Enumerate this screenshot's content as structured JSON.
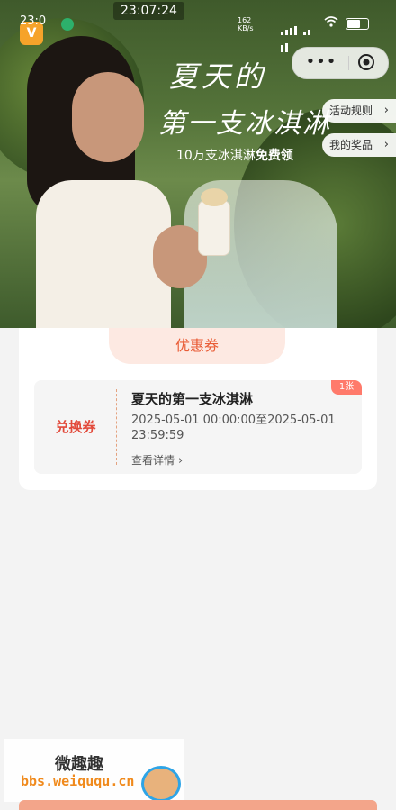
{
  "status_bar": {
    "clock_overlay": "23:07:24",
    "clock": "23:0",
    "speed": "162\nKB/s",
    "signal_label": "HD"
  },
  "hero": {
    "title_line1": "夏天的",
    "title_line2": "第一支冰淇淋",
    "subtitle_prefix": "10万支冰淇淋",
    "subtitle_bold": "免费领"
  },
  "capsule": {
    "more": "•••"
  },
  "side_buttons": {
    "rules": "活动规则",
    "prizes": "我的奖品"
  },
  "coupon_section": {
    "tab_label": "优惠券",
    "coupon": {
      "kind": "兑换券",
      "name": "夏天的第一支冰淇淋",
      "range": "2025-05-01 00:00:00至2025-05-01 23:59:59",
      "detail": "查看详情",
      "count": "1张"
    }
  },
  "watermark": {
    "line1": "微趣趣",
    "line2": "bbs.weiququ.cn"
  },
  "colors": {
    "accent": "#e95c36",
    "coupon_red": "#e24a3b",
    "tab_bg": "#fde9e2",
    "bottom_bar": "#f3a58a"
  },
  "icons": [
    "chevron-right-icon",
    "close-circle-icon",
    "more-icon",
    "wifi-icon",
    "battery-icon"
  ]
}
